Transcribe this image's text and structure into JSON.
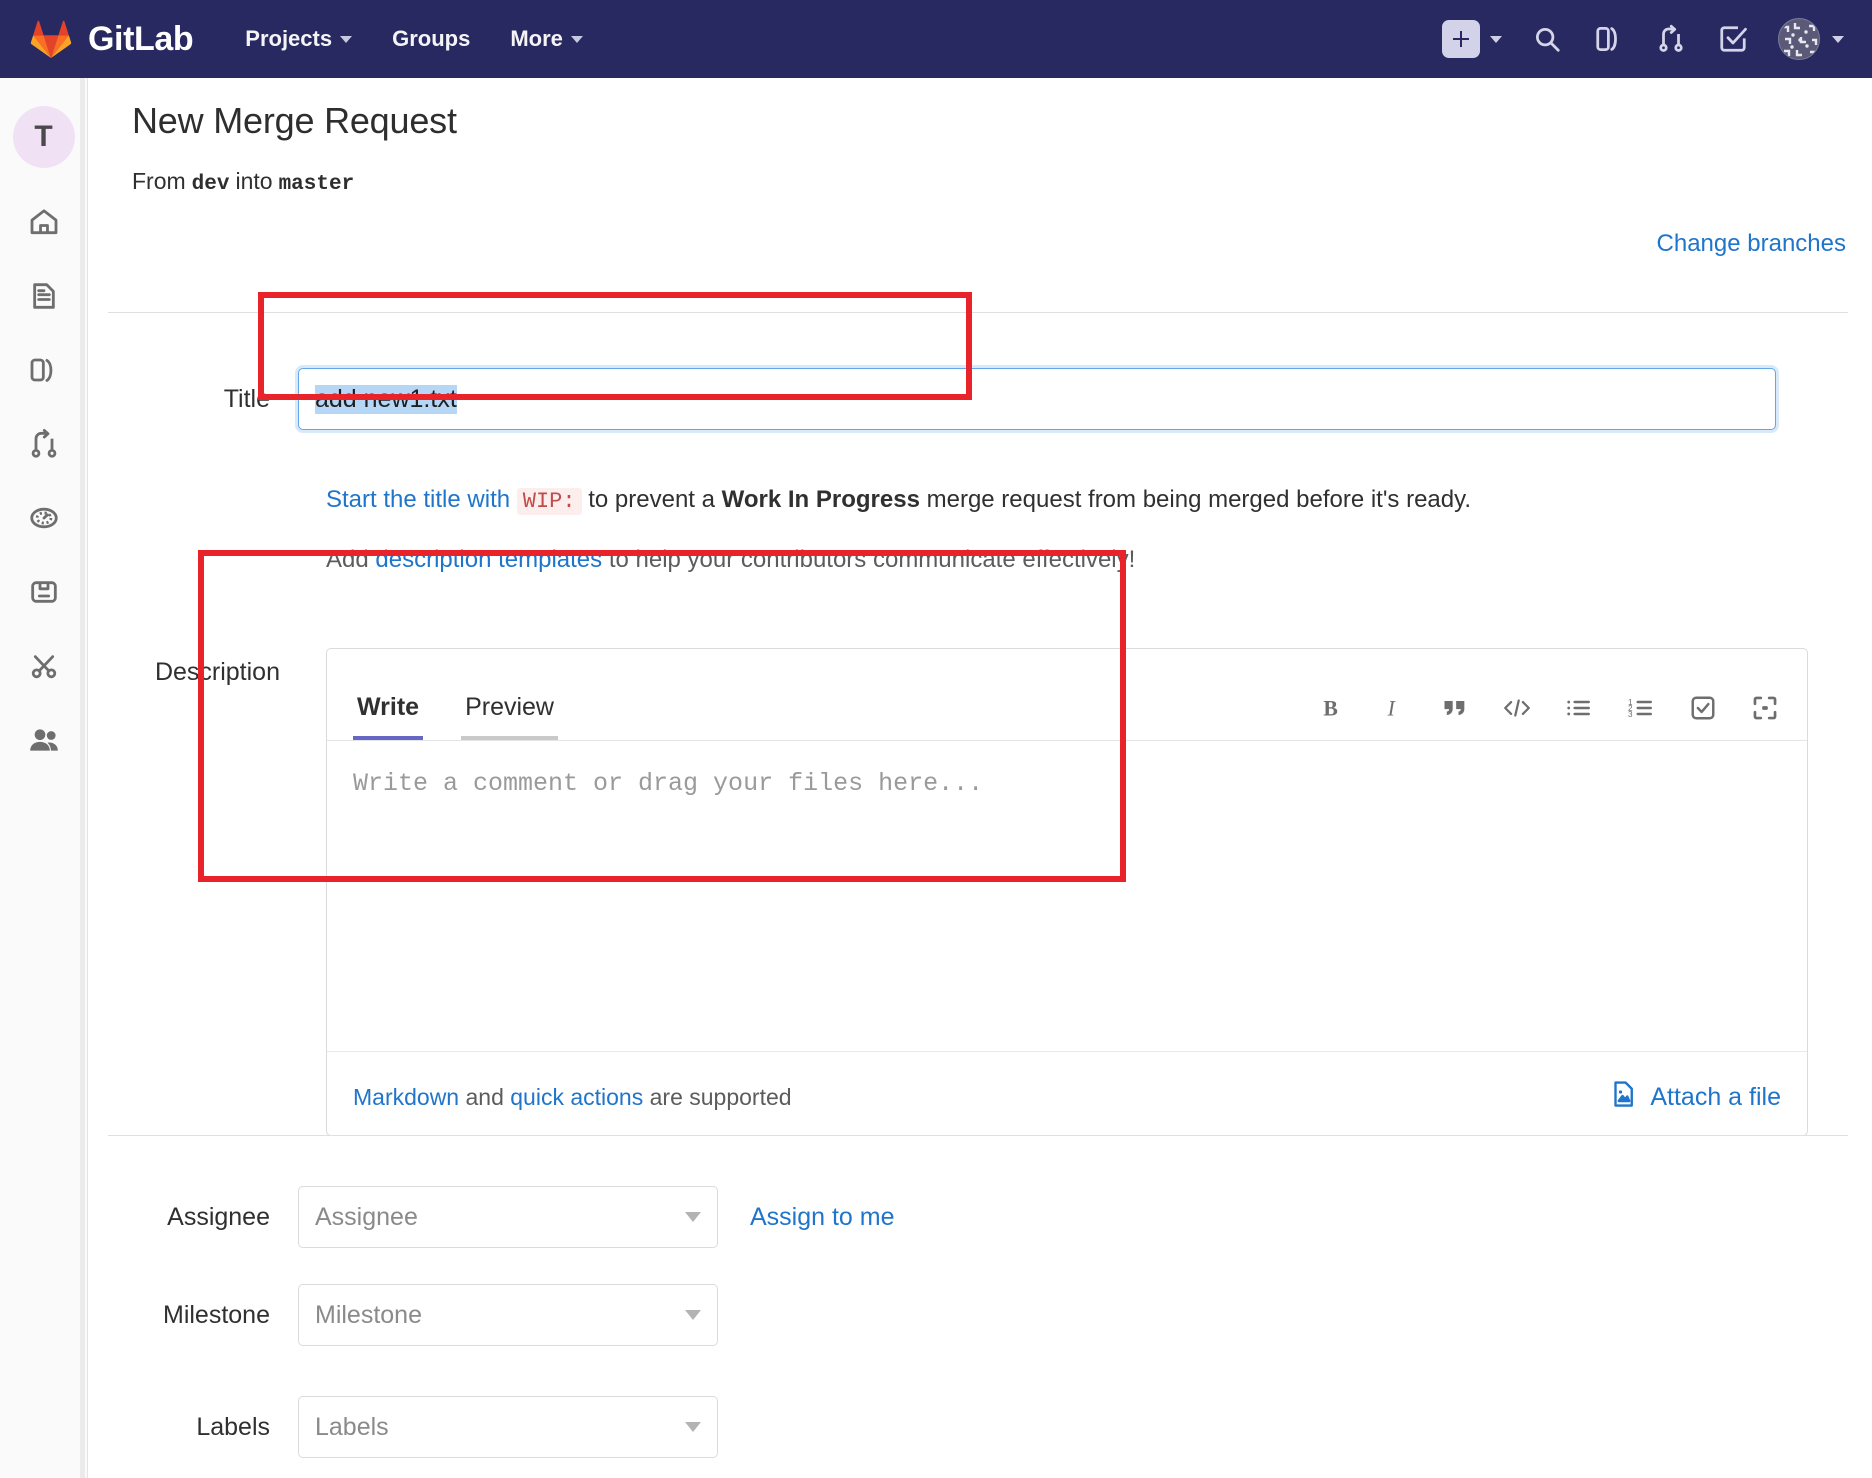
{
  "topnav": {
    "brand": "GitLab",
    "links": [
      {
        "label": "Projects",
        "has_caret": true
      },
      {
        "label": "Groups",
        "has_caret": false
      },
      {
        "label": "More",
        "has_caret": true
      }
    ],
    "icons": [
      "plus-icon",
      "search-icon",
      "issues-icon",
      "merge-requests-icon",
      "todos-icon",
      "user-avatar-icon"
    ],
    "background_color": "#292961"
  },
  "rail": {
    "avatar_initial": "T",
    "items": [
      "home-icon",
      "project-overview-icon",
      "issues-icon",
      "merge-requests-icon",
      "ci-cd-icon",
      "packages-icon",
      "snippets-icon",
      "members-icon"
    ]
  },
  "page": {
    "title": "New Merge Request",
    "from_prefix": "From",
    "source_branch": "dev",
    "into_word": "into",
    "target_branch": "master",
    "change_branches_label": "Change branches"
  },
  "title_field": {
    "label": "Title",
    "value": "add new1.txt",
    "selected": true,
    "hint_prefix": "Start the title with",
    "hint_wip": "WIP:",
    "hint_middle": "to prevent a",
    "hint_bold": "Work In Progress",
    "hint_suffix": "merge request from being merged before it's ready.",
    "templates_prefix": "Add",
    "templates_link": "description templates",
    "templates_suffix": "to help your contributors communicate effectively!"
  },
  "description_field": {
    "label": "Description",
    "tabs": [
      {
        "label": "Write",
        "active": true
      },
      {
        "label": "Preview",
        "active": false
      }
    ],
    "placeholder": "Write a comment or drag your files here...",
    "toolbar": [
      "bold-icon",
      "italic-icon",
      "quote-icon",
      "code-icon",
      "bullet-list-icon",
      "numbered-list-icon",
      "task-list-icon",
      "fullscreen-icon"
    ],
    "footer_markdown": "Markdown",
    "footer_and": "and",
    "footer_quick_actions": "quick actions",
    "footer_supported": "are supported",
    "attach_label": "Attach a file",
    "attach_icon": "attach-image-icon"
  },
  "meta_fields": [
    {
      "label": "Assignee",
      "placeholder": "Assignee",
      "action_label": "Assign to me"
    },
    {
      "label": "Milestone",
      "placeholder": "Milestone",
      "action_label": ""
    },
    {
      "label": "Labels",
      "placeholder": "Labels",
      "action_label": ""
    }
  ],
  "annotations": {
    "color": "#e8242a",
    "boxes": [
      "title-field-highlight",
      "description-field-highlight"
    ]
  }
}
